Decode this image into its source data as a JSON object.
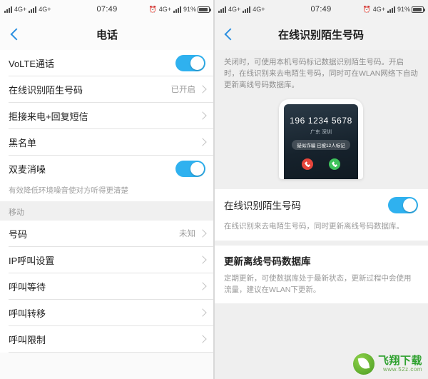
{
  "left_screen": {
    "status_bar": {
      "signal_label_1": "4G+",
      "signal_label_2": "4G+",
      "time": "07:49",
      "signal_label_3": "4G+",
      "battery_percent": "91%",
      "alarm_icon": "alarm-icon"
    },
    "nav": {
      "back_icon": "back-arrow-icon",
      "title": "电话"
    },
    "rows": [
      {
        "label": "VoLTE通话",
        "type": "toggle",
        "value": ""
      },
      {
        "label": "在线识别陌生号码",
        "type": "value",
        "value": "已开启"
      },
      {
        "label": "拒接来电+回复短信",
        "type": "chevron",
        "value": ""
      },
      {
        "label": "黑名单",
        "type": "chevron",
        "value": ""
      },
      {
        "label": "双麦消噪",
        "type": "toggle",
        "value": ""
      }
    ],
    "hint": "有效降低环境噪音使对方听得更清楚",
    "group_title": "移动",
    "rows2": [
      {
        "label": "号码",
        "type": "value",
        "value": "未知"
      },
      {
        "label": "IP呼叫设置",
        "type": "chevron",
        "value": ""
      },
      {
        "label": "呼叫等待",
        "type": "chevron",
        "value": ""
      },
      {
        "label": "呼叫转移",
        "type": "chevron",
        "value": ""
      },
      {
        "label": "呼叫限制",
        "type": "chevron",
        "value": ""
      }
    ]
  },
  "right_screen": {
    "status_bar": {
      "signal_label_1": "4G+",
      "signal_label_2": "4G+",
      "time": "07:49",
      "signal_label_3": "4G+",
      "battery_percent": "91%",
      "alarm_icon": "alarm-icon"
    },
    "nav": {
      "back_icon": "back-arrow-icon",
      "title": "在线识别陌生号码"
    },
    "description": "关闭时，可使用本机号码标记数据识别陌生号码。开启时，在线识别来去电陌生号码，同时可在WLAN网络下自动更新离线号码数据库。",
    "illustration": {
      "phone_number": "196 1234 5678",
      "location": "广东 深圳",
      "tag": "疑似诈骗 已被12人标记",
      "decline_icon": "call-decline-icon",
      "accept_icon": "call-accept-icon"
    },
    "toggle_row": {
      "label": "在线识别陌生号码",
      "toggle_state": "on"
    },
    "toggle_desc": "在线识别来去电陌生号码，同时更新离线号码数据库。",
    "section_title": "更新离线号码数据库",
    "section_desc": "定期更新，可使数据库处于最新状态，更新过程中会使用流量，建议在WLAN下更新。"
  },
  "watermark": {
    "main": "飞翔下载",
    "sub": "www.52z.com",
    "leaf_icon": "leaf-logo-icon"
  },
  "colors": {
    "accent": "#2fb1ef",
    "link": "#2b8fe0",
    "text": "#1f1f1f",
    "muted": "#9a9a9a"
  }
}
